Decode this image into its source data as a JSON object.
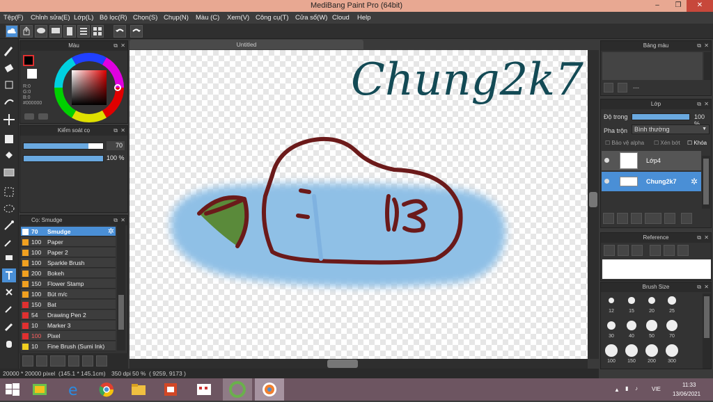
{
  "app": {
    "title": "MediBang Paint Pro (64bit)",
    "doc_tab": "Untitled"
  },
  "window_controls": {
    "minimize": "–",
    "maximize": "❐",
    "close": "✕"
  },
  "menu": [
    "Tệp(F)",
    "Chỉnh sửa(E)",
    "Lớp(L)",
    "Bộ lọc(R)",
    "Chọn(S)",
    "Chụp(N)",
    "Màu (C)",
    "Xem(V)",
    "Công cụ(T)",
    "Cửa sổ(W)",
    "Cloud",
    "Help"
  ],
  "color_panel": {
    "title": "Màu",
    "r": "R:0",
    "g": "G:0",
    "b": "B:0",
    "hex": "#000000"
  },
  "brush_control": {
    "title": "Kiểm soát cọ",
    "size": "70",
    "opacity": "100 %",
    "size_fraction": 0.82,
    "opacity_fraction": 1.0
  },
  "brush_panel": {
    "title": "Cọ: Smudge",
    "items": [
      {
        "size": "70",
        "name": "Smudge",
        "color": "#ffffff",
        "selected": true
      },
      {
        "size": "100",
        "name": "Paper",
        "color": "#f0a020"
      },
      {
        "size": "100",
        "name": "Paper 2",
        "color": "#f0a020"
      },
      {
        "size": "100",
        "name": "Sparkle Brush",
        "color": "#f0a020"
      },
      {
        "size": "200",
        "name": "Bokeh",
        "color": "#f0a020"
      },
      {
        "size": "150",
        "name": "Flower Stamp",
        "color": "#f0a020"
      },
      {
        "size": "100",
        "name": "Bút m/c",
        "color": "#f0a020"
      },
      {
        "size": "150",
        "name": "Bat",
        "color": "#e03030"
      },
      {
        "size": "54",
        "name": "Drawing Pen 2",
        "color": "#e03030"
      },
      {
        "size": "10",
        "name": "Marker 3",
        "color": "#e03030"
      },
      {
        "size": "100",
        "name": "Pixel",
        "color": "#e03030",
        "size_color": "#ff6060"
      },
      {
        "size": "10",
        "name": "Fine Brush (Sumi Ink)",
        "color": "#f0d020"
      }
    ]
  },
  "canvas": {
    "watermark": "Chung2k7"
  },
  "palette_panel": {
    "title": "Bảng màu",
    "placeholder": "---"
  },
  "layer_panel": {
    "title": "Lớp",
    "opacity_label": "Độ trong",
    "opacity_value": "100 %",
    "blend_label": "Pha trộn",
    "blend_value": "Bình thường",
    "protect_alpha": "Bảo vệ alpha",
    "clip": "Xén bớt",
    "lock": "Khóa",
    "layers": [
      {
        "name": "Lớp4",
        "selected": false
      },
      {
        "name": "Chung2k7",
        "selected": true
      }
    ]
  },
  "reference_panel": {
    "title": "Reference"
  },
  "brush_size_panel": {
    "title": "Brush Size",
    "sizes": [
      "12",
      "15",
      "20",
      "25",
      "30",
      "40",
      "50",
      "70",
      "100",
      "150",
      "200",
      "300"
    ]
  },
  "status": {
    "dimensions": "20000 * 20000 pixel",
    "physical": "(145.1 * 145.1cm)",
    "dpi": "350 dpi",
    "zoom": "50 %",
    "cursor": "( 9259, 9173 )"
  },
  "taskbar": {
    "lang": "VIE",
    "time": "11:33",
    "date": "13/06/2021"
  },
  "colors": {
    "accent": "#4a8fd6",
    "stroke": "#6b1a1a",
    "blue_wash": "#8fc0e6",
    "leaf": "#5a8a3a"
  }
}
